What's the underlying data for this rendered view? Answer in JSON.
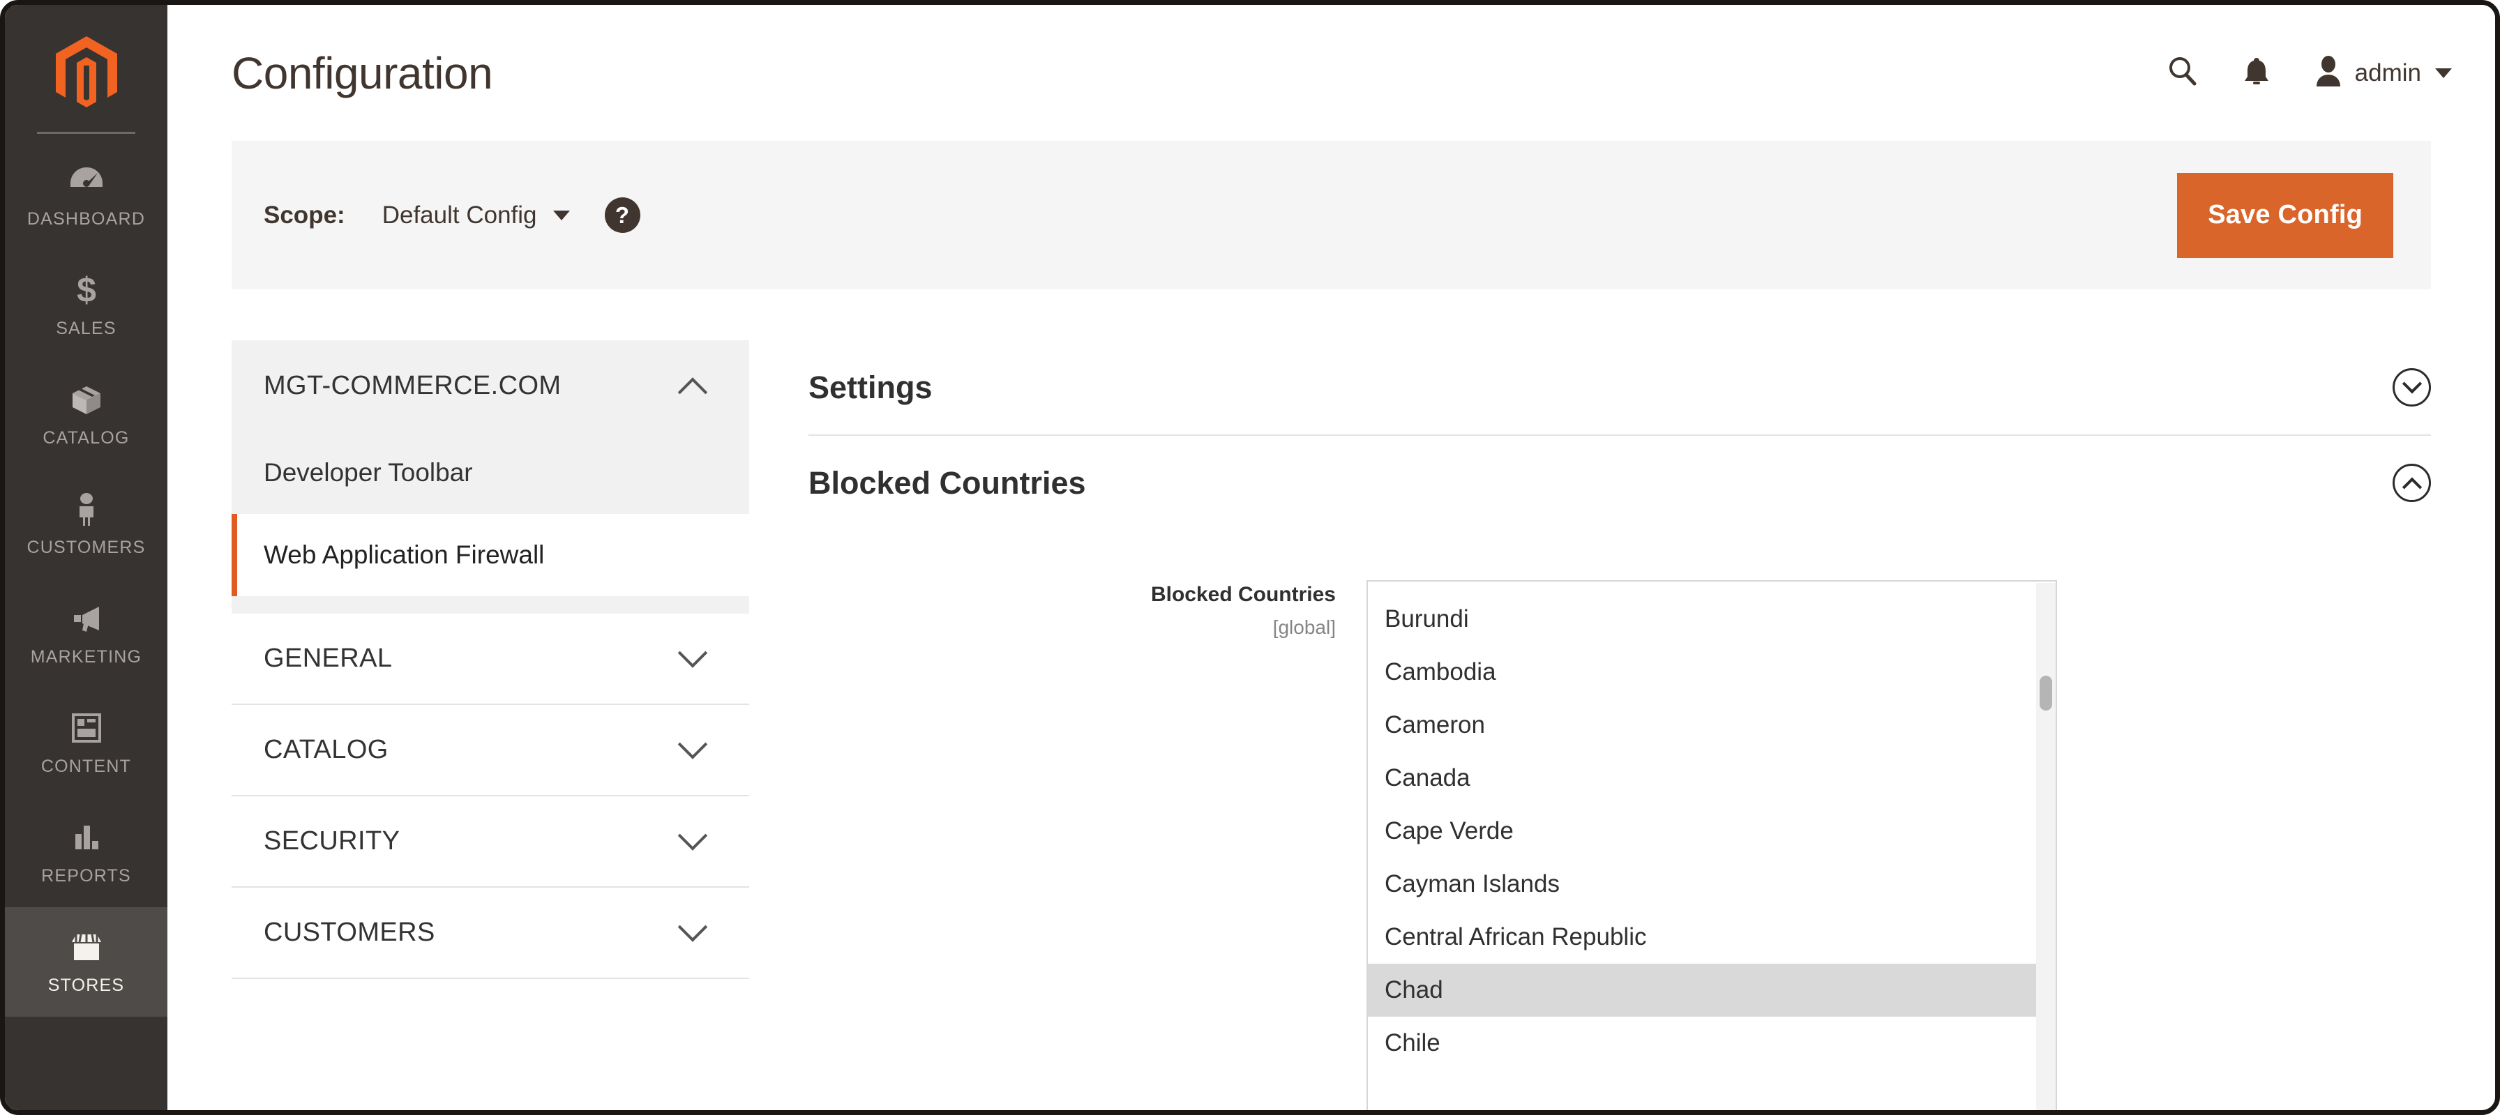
{
  "colors": {
    "brand_orange": "#d9652b",
    "accent_orange": "#e05a22",
    "nav_dark": "#373330",
    "nav_active": "#4f4b48",
    "text_dark": "#41362f",
    "panel_grey": "#f5f5f5"
  },
  "global_nav": {
    "logo_name": "magento-logo-icon",
    "items": [
      {
        "label": "DASHBOARD",
        "icon": "dashboard-gauge-icon",
        "active": false
      },
      {
        "label": "SALES",
        "icon": "dollar-sign-icon",
        "active": false
      },
      {
        "label": "CATALOG",
        "icon": "box-icon",
        "active": false
      },
      {
        "label": "CUSTOMERS",
        "icon": "person-icon",
        "active": false
      },
      {
        "label": "MARKETING",
        "icon": "megaphone-icon",
        "active": false
      },
      {
        "label": "CONTENT",
        "icon": "layout-page-icon",
        "active": false
      },
      {
        "label": "REPORTS",
        "icon": "bar-chart-icon",
        "active": false
      },
      {
        "label": "STORES",
        "icon": "storefront-icon",
        "active": true
      }
    ]
  },
  "header": {
    "title": "Configuration",
    "search_icon": "search-icon",
    "notifications_icon": "bell-icon",
    "user_icon": "avatar-icon",
    "user_name": "admin",
    "user_caret_icon": "caret-down-icon"
  },
  "scope_bar": {
    "label": "Scope:",
    "value": "Default Config",
    "caret_icon": "caret-down-icon",
    "help_icon": "question-mark-icon",
    "help_glyph": "?",
    "save_label": "Save Config"
  },
  "config_nav": {
    "sections": [
      {
        "label": "MGT-COMMERCE.COM",
        "open": true,
        "chevron": "chevron-up-icon",
        "items": [
          {
            "label": "Developer Toolbar",
            "current": false
          },
          {
            "label": "Web Application Firewall",
            "current": true
          }
        ]
      },
      {
        "label": "GENERAL",
        "open": false,
        "chevron": "chevron-down-icon",
        "items": []
      },
      {
        "label": "CATALOG",
        "open": false,
        "chevron": "chevron-down-icon",
        "items": []
      },
      {
        "label": "SECURITY",
        "open": false,
        "chevron": "chevron-down-icon",
        "items": []
      },
      {
        "label": "CUSTOMERS",
        "open": false,
        "chevron": "chevron-down-icon",
        "items": []
      }
    ]
  },
  "settings_panel": {
    "settings_section": {
      "title": "Settings",
      "expanded": false,
      "toggle_icon": "chevron-down-circle-icon"
    },
    "blocked_section": {
      "title": "Blocked Countries",
      "expanded": true,
      "toggle_icon": "chevron-up-circle-icon"
    },
    "field": {
      "label": "Blocked Countries",
      "scope_note": "[global]",
      "selected": [
        "Chad"
      ],
      "options": [
        "Burundi",
        "Cambodia",
        "Cameron",
        "Canada",
        "Cape Verde",
        "Cayman Islands",
        "Central African Republic",
        "Chad",
        "Chile"
      ]
    }
  }
}
